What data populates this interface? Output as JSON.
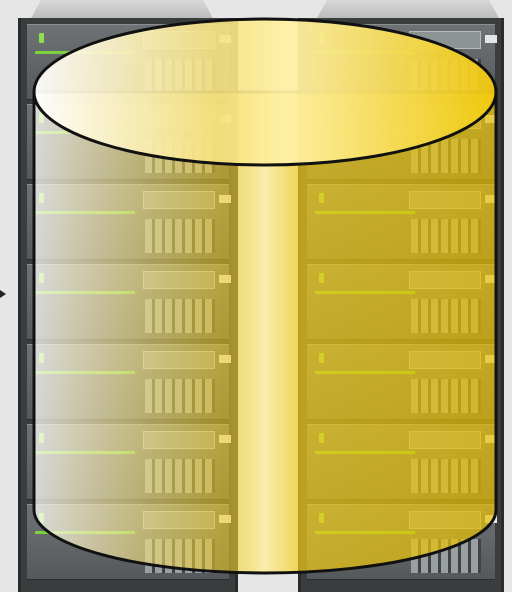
{
  "colors": {
    "background": "#e6e6e6",
    "rack": "#3a3d3e",
    "indicator_green": "#7bd23c",
    "cylinder_gold": "#f2cc16",
    "cylinder_highlight": "#fff0a0",
    "outline": "#111111"
  },
  "icons": {
    "main": "database-cylinder-icon",
    "pointer": "arrow-right-icon"
  }
}
